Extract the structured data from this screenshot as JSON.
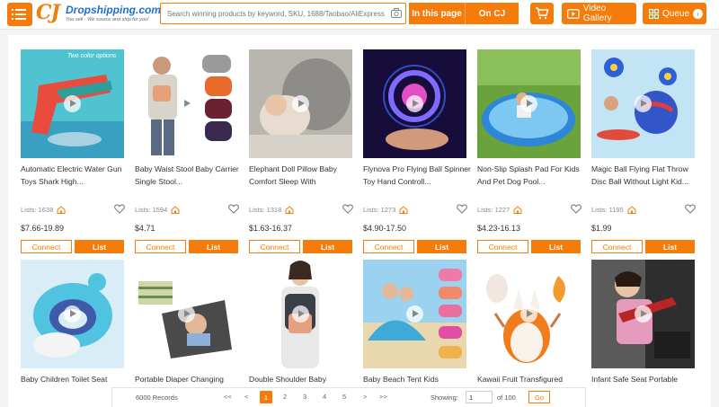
{
  "header": {
    "logo_name": "Dropshipping.com",
    "logo_tag": "You sell · We source and ship for you!",
    "search_placeholder": "Search winning products by keyword, SKU, 1688/Taobao/AliExpress URL",
    "scope_page": "In this page",
    "scope_cj": "On CJ",
    "video_gallery": "Video Gallery",
    "queue": "Queue"
  },
  "products": [
    {
      "title": "Automatic Electric Water Gun Toys Shark High...",
      "lists": "Lists: 1638",
      "price": "$7.66-19.89",
      "connect": "Connect",
      "list": "List",
      "image_text": "Two color options"
    },
    {
      "title": "Baby Waist Stool Baby Carrier Single Stool...",
      "lists": "Lists: 1594",
      "price": "$4.71",
      "connect": "Connect",
      "list": "List"
    },
    {
      "title": "Elephant Doll Pillow Baby Comfort Sleep With",
      "lists": "Lists: 1318",
      "price": "$1.63-16.37",
      "connect": "Connect",
      "list": "List"
    },
    {
      "title": "Flynova Pro Flying Ball Spinner Toy Hand Controll...",
      "lists": "Lists: 1273",
      "price": "$4.90-17.50",
      "connect": "Connect",
      "list": "List"
    },
    {
      "title": "Non-Slip Splash Pad For Kids And Pet Dog Pool...",
      "lists": "Lists: 1227",
      "price": "$4.23-16.13",
      "connect": "Connect",
      "list": "List"
    },
    {
      "title": "Magic Ball Flying Flat Throw Disc Ball Without Light Kid...",
      "lists": "Lists: 1195",
      "price": "$1.99",
      "connect": "Connect",
      "list": "List"
    },
    {
      "title": "Baby Children Toilet Seat"
    },
    {
      "title": "Portable Diaper Changing"
    },
    {
      "title": "Double Shoulder Baby"
    },
    {
      "title": "Baby Beach Tent Kids"
    },
    {
      "title": "Kawaii Fruit Transfigured"
    },
    {
      "title": "Infant Safe Seat Portable"
    }
  ],
  "pager": {
    "records": "6000 Records",
    "first": "<<",
    "prev": "<",
    "pages": [
      "1",
      "2",
      "3",
      "4",
      "5"
    ],
    "next": ">",
    "last": ">>",
    "showing": "Showing:",
    "current": "1",
    "of_total": "of 100",
    "go": "Go"
  },
  "colors": {
    "accent": "#f57c0a",
    "link": "#1f6fd0"
  },
  "icons": [
    "menu-icon",
    "camera-icon",
    "cart-icon",
    "video-icon",
    "queue-icon",
    "play-icon",
    "house-icon",
    "heart-icon"
  ]
}
